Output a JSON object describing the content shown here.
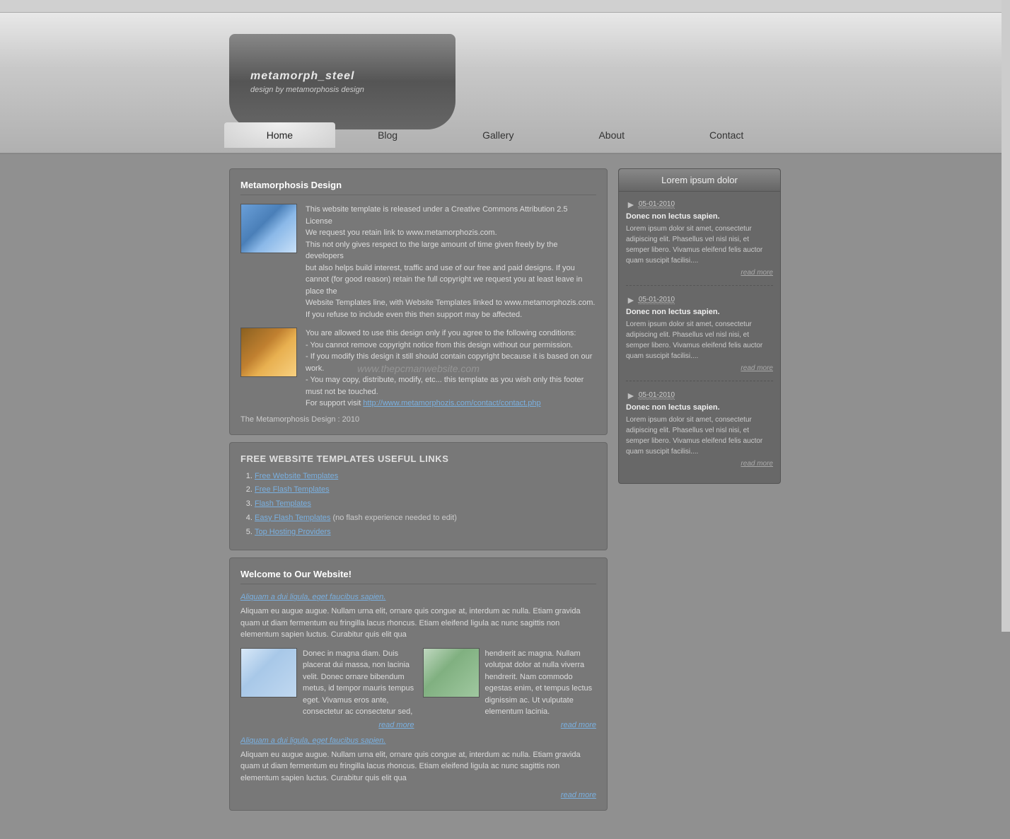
{
  "topbar": {},
  "header": {
    "site_title": "metamorph_steel",
    "site_subtitle": "design by metamorphosis design"
  },
  "nav": {
    "items": [
      {
        "label": "Home",
        "active": true
      },
      {
        "label": "Blog",
        "active": false
      },
      {
        "label": "Gallery",
        "active": false
      },
      {
        "label": "About",
        "active": false
      },
      {
        "label": "Contact",
        "active": false
      }
    ]
  },
  "main": {
    "content_title": "Metamorphosis Design",
    "intro_para1": "This website template is released under a Creative Commons Attribution 2.5 License",
    "intro_para2": "We request you retain link to www.metamorphozis.com.",
    "intro_para3": "This not only gives respect to the large amount of time given freely by the developers",
    "intro_para4": "but also helps build interest, traffic and use of our free and paid designs. If you cannot (for good reason) retain the full copyright we request you at least leave in place the",
    "intro_para5": "Website Templates line, with Website Templates linked to www.metamorphozis.com. If you refuse to include even this then support may be affected.",
    "license_para1": "You are allowed to use this design only if you agree to the following conditions:",
    "license_para2": "- You cannot remove copyright notice from this design without our permission.",
    "license_para3": "- If you modify this design it still should contain copyright because it is based on our work.",
    "license_para4": "- You may copy, distribute, modify, etc... this template as you wish only this footer must not be touched.",
    "license_para5": "For support visit",
    "license_link_text": "http://www.metamorphozis.com/contact/contact.php",
    "copyright_line": "The Metamorphosis Design : 2010",
    "watermark_text": "www.thepcmanwebsite.com",
    "links_title": "FREE WEBSITE TEMPLATES USEFUL LINKS",
    "links": [
      {
        "text": "Free Website Templates",
        "href": "#"
      },
      {
        "text": "Free Flash Templates",
        "href": "#"
      },
      {
        "text": "Flash Templates",
        "href": "#"
      },
      {
        "text": "Easy Flash Templates",
        "href": "#",
        "suffix": "(no flash experience needed to edit)"
      },
      {
        "text": "Top Hosting Providers",
        "href": "#"
      }
    ],
    "welcome_title": "Welcome to Our Website!",
    "welcome_lead": "Aliquam a dui ligula, eget faucibus sapien.",
    "welcome_text": "Aliquam eu augue augue. Nullam urna elit, ornare quis congue at, interdum ac nulla. Etiam gravida quam ut diam fermentum eu fringilla lacus rhoncus. Etiam eleifend ligula ac nunc sagittis non elementum sapien luctus. Curabitur quis elit qua",
    "col1_text": "Donec in magna diam. Duis placerat dui massa, non lacinia velit. Donec ornare bibendum metus, id tempor mauris tempus eget. Vivamus eros ante, consectetur ac consectetur sed,",
    "col2_text": "hendrerit ac magna. Nullam volutpat dolor at nulla viverra hendrerit. Nam commodo egestas enim, et tempus lectus dignissim ac. Ut vulputate elementum lacinia.",
    "read_more": "read more",
    "welcome_lead2": "Aliquam a dui ligula, eget faucibus sapien.",
    "welcome_text2": "Aliquam eu augue augue. Nullam urna elit, ornare quis congue at, interdum ac nulla. Etiam gravida quam ut diam fermentum eu fringilla lacus rhoncus. Etiam eleifend ligula ac nunc sagittis non elementum sapien luctus. Curabitur quis elit qua",
    "read_more2": "read more"
  },
  "sidebar": {
    "title": "Lorem ipsum dolor",
    "items": [
      {
        "date": "05-01-2010",
        "heading": "Donec non lectus sapien.",
        "body": "Lorem ipsum dolor sit amet, consectetur adipiscing elit. Phasellus vel nisl nisi, et semper libero. Vivamus eleifend felis auctor quam suscipit facilisi....",
        "read_more": "read more"
      },
      {
        "date": "05-01-2010",
        "heading": "Donec non lectus sapien.",
        "body": "Lorem ipsum dolor sit amet, consectetur adipiscing elit. Phasellus vel nisl nisi, et semper libero. Vivamus eleifend felis auctor quam suscipit facilisi....",
        "read_more": "read more"
      },
      {
        "date": "05-01-2010",
        "heading": "Donec non lectus sapien.",
        "body": "Lorem ipsum dolor sit amet, consectetur adipiscing elit. Phasellus vel nisl nisi, et semper libero. Vivamus eleifend felis auctor quam suscipit facilisi....",
        "read_more": "read more"
      }
    ]
  }
}
